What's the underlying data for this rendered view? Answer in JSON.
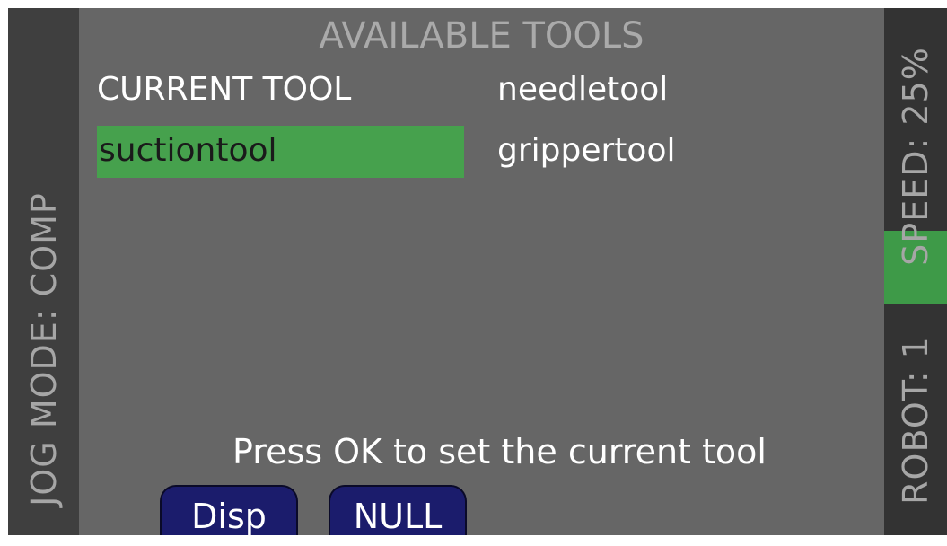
{
  "side": {
    "jog_mode": "JOG MODE: COMP",
    "speed": "SPEED: 25%",
    "robot": "ROBOT: 1"
  },
  "panel": {
    "title": "AVAILABLE TOOLS",
    "current_tool_label": "CURRENT TOOL",
    "tools": {
      "selected": "suctiontool",
      "col2_row1": "needletool",
      "col2_row2": "grippertool"
    },
    "instruction": "Press OK to set the current tool"
  },
  "softkeys": {
    "disp": "Disp",
    "null": "NULL"
  },
  "colors": {
    "highlight": "#46a14d",
    "panel_bg": "#666666",
    "softkey_bg": "#1b1c6c"
  }
}
